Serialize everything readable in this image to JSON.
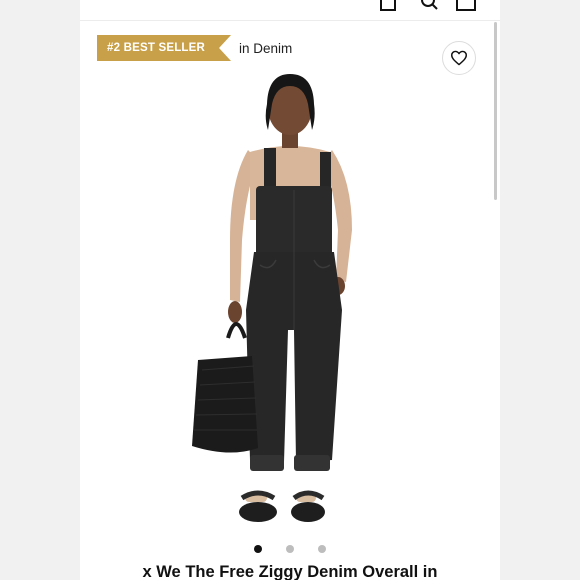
{
  "header": {
    "account_icon": "bag-icon",
    "search_icon": "search-icon",
    "cart_icon": "cart-icon"
  },
  "badge": {
    "label": "#2 BEST SELLER",
    "category": "in Denim",
    "color": "#c9a04a"
  },
  "wishlist": {
    "icon": "heart-icon"
  },
  "carousel": {
    "total": 3,
    "active_index": 0
  },
  "product": {
    "title": "x We The Free Ziggy Denim Overall in"
  }
}
